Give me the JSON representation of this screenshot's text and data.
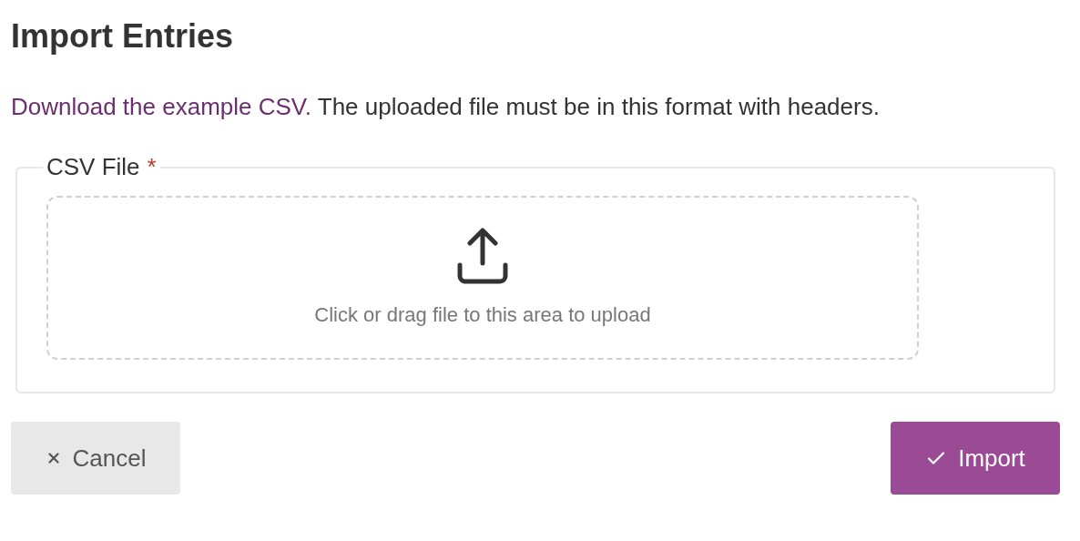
{
  "title": "Import Entries",
  "intro": {
    "link": "Download the example CSV.",
    "text": "The uploaded file must be in this format with headers."
  },
  "field": {
    "label": "CSV File",
    "required_mark": "*",
    "required": true,
    "dropzone_text": "Click or drag file to this area to upload"
  },
  "buttons": [
    {
      "label": "Cancel",
      "kind": "cancel"
    },
    {
      "label": "Import",
      "kind": "primary"
    }
  ]
}
